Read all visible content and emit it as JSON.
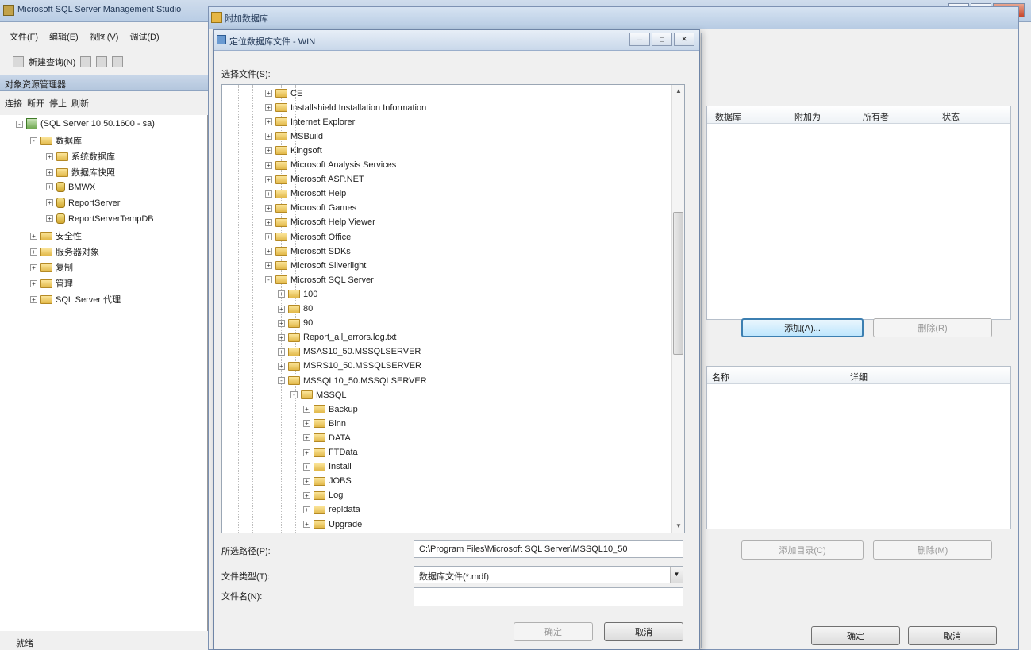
{
  "ssms": {
    "title": "Microsoft SQL Server Management Studio",
    "menu": [
      "文件(F)",
      "编辑(E)",
      "视图(V)",
      "调试(D)"
    ],
    "toolbar_new_query": "新建查询(N)",
    "object_explorer_title": "对象资源管理器",
    "oe_tools": [
      "连接",
      "断开",
      "停止",
      "刷新"
    ],
    "tree": [
      {
        "label": "(SQL Server 10.50.1600 - sa)",
        "icon": "server-icon",
        "exp": "-"
      },
      {
        "label": "数据库",
        "icon": "folder-icon",
        "exp": "-"
      },
      {
        "label": "系统数据库",
        "icon": "folder-icon",
        "exp": "+"
      },
      {
        "label": "数据库快照",
        "icon": "folder-icon",
        "exp": "+"
      },
      {
        "label": "BMWX",
        "icon": "database-icon",
        "exp": "+"
      },
      {
        "label": "ReportServer",
        "icon": "database-icon",
        "exp": "+"
      },
      {
        "label": "ReportServerTempDB",
        "icon": "database-icon",
        "exp": "+"
      },
      {
        "label": "安全性",
        "icon": "folder-icon",
        "exp": "+"
      },
      {
        "label": "服务器对象",
        "icon": "folder-icon",
        "exp": "+"
      },
      {
        "label": "复制",
        "icon": "folder-icon",
        "exp": "+"
      },
      {
        "label": "管理",
        "icon": "folder-icon",
        "exp": "+"
      },
      {
        "label": "SQL Server 代理",
        "icon": "agent-icon",
        "exp": "+"
      }
    ],
    "status": "就绪"
  },
  "attach": {
    "title": "附加数据库",
    "grid1_headers": [
      "数据库",
      "附加为",
      "所有者",
      "状态"
    ],
    "add_button": "添加(A)...",
    "remove_button": "删除(R)",
    "grid2_headers": [
      "名称",
      "详细"
    ],
    "add_catalog_button": "添加目录(C)",
    "remove_button2": "删除(M)",
    "ok_button": "确定",
    "cancel_button": "取消"
  },
  "dialog": {
    "title": "定位数据库文件 - WIN",
    "select_file_label": "选择文件(S):",
    "tree_rows": [
      {
        "label": "CE",
        "depth": 0,
        "exp": "+"
      },
      {
        "label": "Installshield Installation Information",
        "depth": 0,
        "exp": "+"
      },
      {
        "label": "Internet Explorer",
        "depth": 0,
        "exp": "+"
      },
      {
        "label": "MSBuild",
        "depth": 0,
        "exp": "+"
      },
      {
        "label": "Kingsoft",
        "depth": 0,
        "exp": "+"
      },
      {
        "label": "Microsoft Analysis Services",
        "depth": 0,
        "exp": "+"
      },
      {
        "label": "Microsoft ASP.NET",
        "depth": 0,
        "exp": "+"
      },
      {
        "label": "Microsoft Help",
        "depth": 0,
        "exp": "+"
      },
      {
        "label": "Microsoft Games",
        "depth": 0,
        "exp": "+"
      },
      {
        "label": "Microsoft Help Viewer",
        "depth": 0,
        "exp": "+"
      },
      {
        "label": "Microsoft Office",
        "depth": 0,
        "exp": "+"
      },
      {
        "label": "Microsoft SDKs",
        "depth": 0,
        "exp": "+"
      },
      {
        "label": "Microsoft Silverlight",
        "depth": 0,
        "exp": "+"
      },
      {
        "label": "Microsoft SQL Server",
        "depth": 0,
        "exp": "-"
      },
      {
        "label": "100",
        "depth": 1,
        "exp": "+"
      },
      {
        "label": "80",
        "depth": 1,
        "exp": "+"
      },
      {
        "label": "90",
        "depth": 1,
        "exp": "+"
      },
      {
        "label": "Report_all_errors.log.txt",
        "depth": 1,
        "exp": "+"
      },
      {
        "label": "MSAS10_50.MSSQLSERVER",
        "depth": 1,
        "exp": "+"
      },
      {
        "label": "MSRS10_50.MSSQLSERVER",
        "depth": 1,
        "exp": "+"
      },
      {
        "label": "MSSQL10_50.MSSQLSERVER",
        "depth": 1,
        "exp": "-"
      },
      {
        "label": "MSSQL",
        "depth": 2,
        "exp": "-"
      },
      {
        "label": "Backup",
        "depth": 3,
        "exp": "+"
      },
      {
        "label": "Binn",
        "depth": 3,
        "exp": "+"
      },
      {
        "label": "DATA",
        "depth": 3,
        "exp": "+"
      },
      {
        "label": "FTData",
        "depth": 3,
        "exp": "+"
      },
      {
        "label": "Install",
        "depth": 3,
        "exp": "+"
      },
      {
        "label": "JOBS",
        "depth": 3,
        "exp": "+"
      },
      {
        "label": "Log",
        "depth": 3,
        "exp": "+"
      },
      {
        "label": "repldata",
        "depth": 3,
        "exp": "+"
      },
      {
        "label": "Upgrade",
        "depth": 3,
        "exp": "+"
      }
    ],
    "selected_path_label": "所选路径(P):",
    "selected_path_value": "C:\\Program Files\\Microsoft SQL Server\\MSSQL10_50",
    "file_type_label": "文件类型(T):",
    "file_type_value": "数据库文件(*.mdf)",
    "file_name_label": "文件名(N):",
    "file_name_value": "",
    "ok_button": "确定",
    "cancel_button": "取消"
  }
}
